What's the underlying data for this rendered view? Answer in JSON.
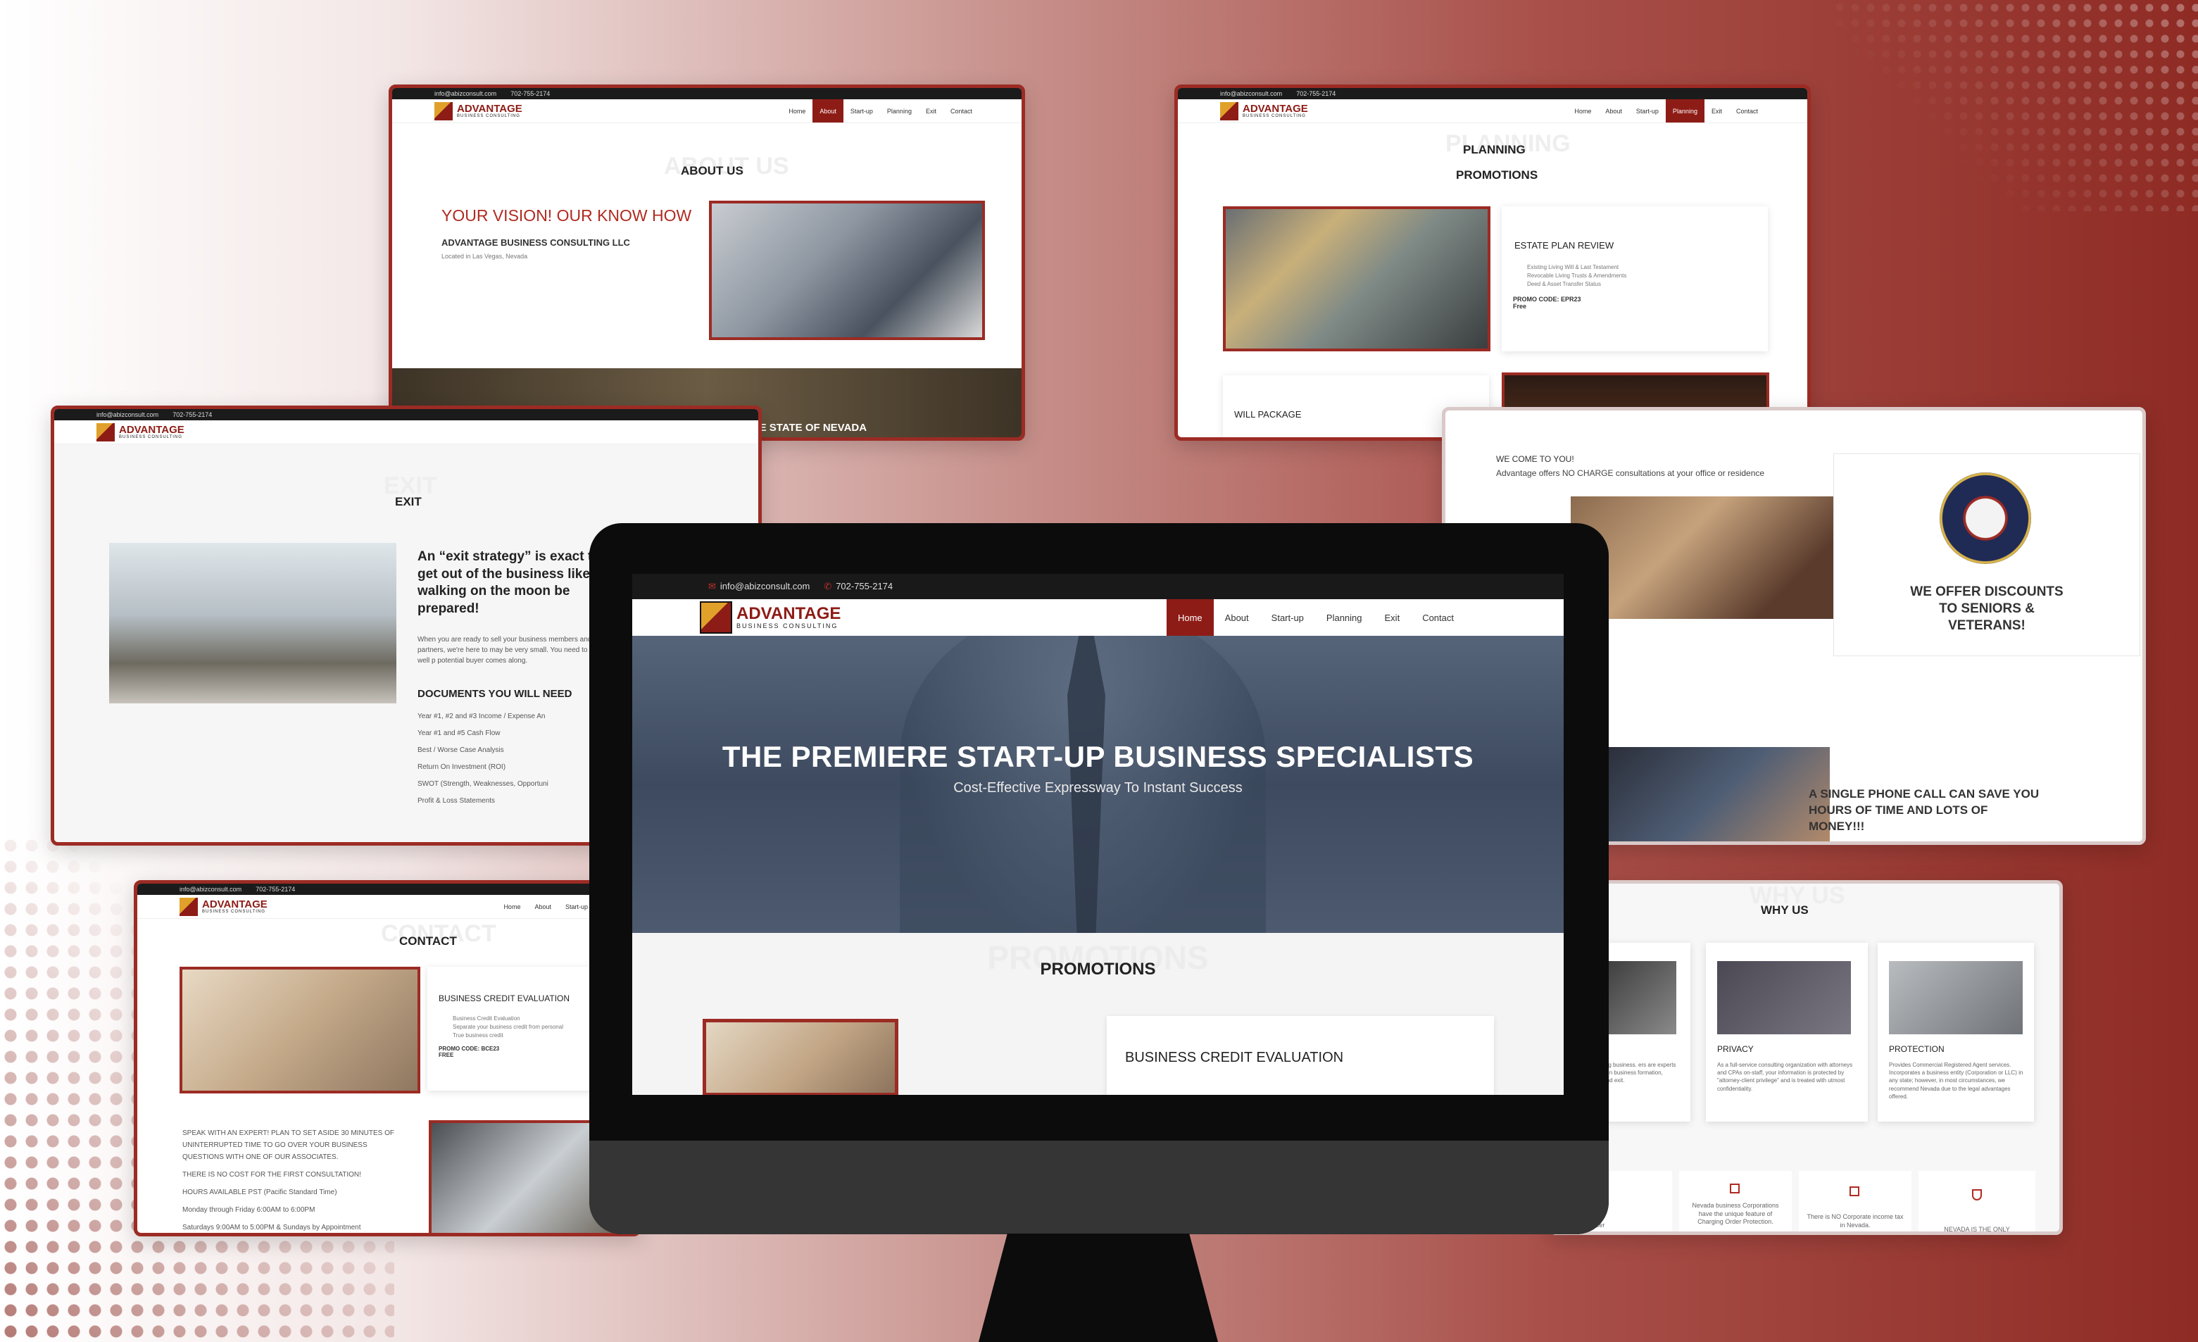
{
  "site": {
    "email": "info@abizconsult.com",
    "phone": "702-755-2174",
    "logo_name": "ADVANTAGE",
    "logo_tagline": "BUSINESS CONSULTING",
    "nav": [
      "Home",
      "About",
      "Start-up",
      "Planning",
      "Exit",
      "Contact"
    ]
  },
  "monitor": {
    "active_nav": "Home",
    "hero_title": "THE PREMIERE START-UP BUSINESS SPECIALISTS",
    "hero_subtitle": "Cost-Effective Expressway To Instant Success",
    "section_ghost": "PROMOTIONS",
    "section_title": "PROMOTIONS",
    "card_title": "BUSINESS CREDIT EVALUATION"
  },
  "about": {
    "ghost": "ABOUT US",
    "title": "ABOUT US",
    "headline": "YOUR VISION! OUR KNOW HOW",
    "company": "ADVANTAGE BUSINESS CONSULTING LLC",
    "location": "Located in Las Vegas, Nevada",
    "banner": "ADVANTAGES OF INCORPORATING IN THE STATE OF NEVADA"
  },
  "planning": {
    "ghost": "PLANNING",
    "title": "PLANNING",
    "subtitle": "PROMOTIONS",
    "card_title": "ESTATE PLAN REVIEW",
    "items": [
      "Existing Living Will & Last Testament",
      "Revocable Living Trusts & Amendments",
      "Deed & Asset Transfer Status"
    ],
    "promo_code": "PROMO CODE: EPR23",
    "price": "Free",
    "card2_title": "WILL PACKAGE"
  },
  "exit": {
    "ghost": "EXIT",
    "title": "EXIT",
    "quote": "An “exit strategy” is exact to get out of the business like walking on the moon be prepared!",
    "body": "When you are ready to sell your business members and/or partners, we're here to may be very small. You need to be well p potential buyer comes along.",
    "docs_title": "DOCUMENTS YOU WILL NEED",
    "docs": [
      "Year #1, #2 and #3 Income / Expense An",
      "Year #1 and #5 Cash Flow",
      "Best / Worse Case Analysis",
      "Return On Investment (ROI)",
      "SWOT (Strength, Weaknesses, Opportuni",
      "Profit & Loss Statements"
    ]
  },
  "welcome": {
    "heading": "WE COME TO YOU!",
    "text": "Advantage offers NO CHARGE consultations at your office or residence",
    "discount": "WE OFFER DISCOUNTS TO SENIORS & VETERANS!",
    "phone_call": "A SINGLE PHONE CALL CAN SAVE YOU HOURS OF TIME AND LOTS OF MONEY!!!"
  },
  "contact": {
    "ghost": "CONTACT",
    "title": "CONTACT",
    "card_title": "BUSINESS CREDIT EVALUATION",
    "items": [
      "Business Credit Evaluation",
      "Separate your business credit from personal",
      "True business credit"
    ],
    "promo_code": "PROMO CODE: BCE23",
    "price": "FREE",
    "lines": [
      "SPEAK WITH AN EXPERT! PLAN TO SET ASIDE 30 MINUTES OF UNINTERRUPTED TIME TO GO OVER YOUR BUSINESS QUESTIONS WITH ONE OF OUR ASSOCIATES.",
      "THERE IS NO COST FOR THE FIRST CONSULTATION!",
      "HOURS AVAILABLE PST (Pacific Standard Time)",
      "Monday through Friday 6:00AM to 6:00PM",
      "Saturdays 9:00AM to 5:00PM & Sundays by Appointment"
    ]
  },
  "whyus": {
    "ghost": "WHY US",
    "title": "WHY US",
    "cards": [
      {
        "title": "",
        "text": "in the consulting business. ers are experts in business ce in business formation, preservation and exit."
      },
      {
        "title": "PRIVACY",
        "text": "As a full-service consulting organization with attorneys and CPAs on-staff, your information is protected by \"attorney-client privilege\" and is treated with utmost confidentiality."
      },
      {
        "title": "PROTECTION",
        "text": "Provides Commercial Registered Agent services. Incorporates a business entity (Corporation or LLC) in any state; however, in most circumstances, we recommend Nevada due to the legal advantages offered."
      }
    ],
    "bottom": [
      "rate Officer",
      "Nevada business Corporations have the unique feature of Charging Order Protection.",
      "There is NO Corporate income tax in Nevada.",
      "NEVADA IS THE ONLY"
    ]
  }
}
